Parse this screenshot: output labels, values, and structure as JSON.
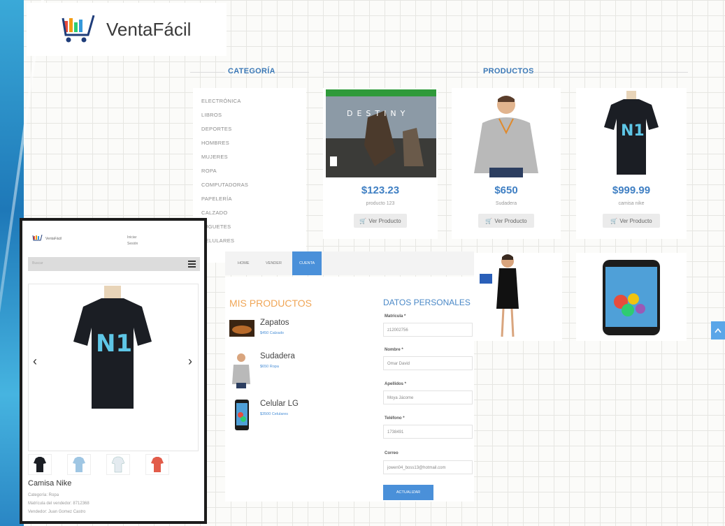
{
  "brand": {
    "name": "VentaFácil"
  },
  "categories": {
    "title": "CATEGORÍA",
    "items": [
      "ELECTRÓNICA",
      "LIBROS",
      "DEPORTES",
      "HOMBRES",
      "MUJERES",
      "ROPA",
      "COMPUTADORAS",
      "PAPELERÍA",
      "CALZADO",
      "JUGUETES",
      "CELULARES"
    ]
  },
  "products": {
    "title": "PRODUCTOS",
    "items": [
      {
        "price": "$123.23",
        "name": "producto 123",
        "button": "Ver Producto"
      },
      {
        "price": "$650",
        "name": "Sudadera",
        "button": "Ver Producto"
      },
      {
        "price": "$999.99",
        "name": "camisa nike",
        "button": "Ver Producto"
      }
    ]
  },
  "account_nav": {
    "items": [
      "HOME",
      "VENDER",
      "CUENTA"
    ],
    "active": "CUENTA"
  },
  "my_products": {
    "title": "MIS PRODUCTOS",
    "items": [
      {
        "name": "Zapatos",
        "meta": "$450  Calzado"
      },
      {
        "name": "Sudadera",
        "meta": "$650  Ropa"
      },
      {
        "name": "Celular LG",
        "meta": "$3500  Celulares"
      }
    ]
  },
  "personal_data": {
    "title": "DATOS PERSONALES",
    "fields": [
      {
        "label": "Matrícula *",
        "value": "z12002756"
      },
      {
        "label": "Nombre *",
        "value": "Omar David"
      },
      {
        "label": "Apellidos *",
        "value": "Moya Jácome"
      },
      {
        "label": "Teléfono *",
        "value": "1738491"
      },
      {
        "label": "Correo",
        "value": "jowen04_boss13@hotmail.com"
      }
    ],
    "button": "ACTUALIZAR"
  },
  "mobile": {
    "brand": "VentaFácil",
    "login": [
      "Iniciar",
      "Sesión"
    ],
    "search_hint": "Buscar",
    "product_title": "Camisa Nike",
    "category": "Categoría: Ropa",
    "seller_id": "Matrícula del vendedor: 8712368",
    "seller": "Vendedor: Juan  Gomez Castro"
  },
  "colors": {
    "accent": "#4a90d9",
    "price": "#3f7fc3",
    "orange": "#f0a657"
  }
}
